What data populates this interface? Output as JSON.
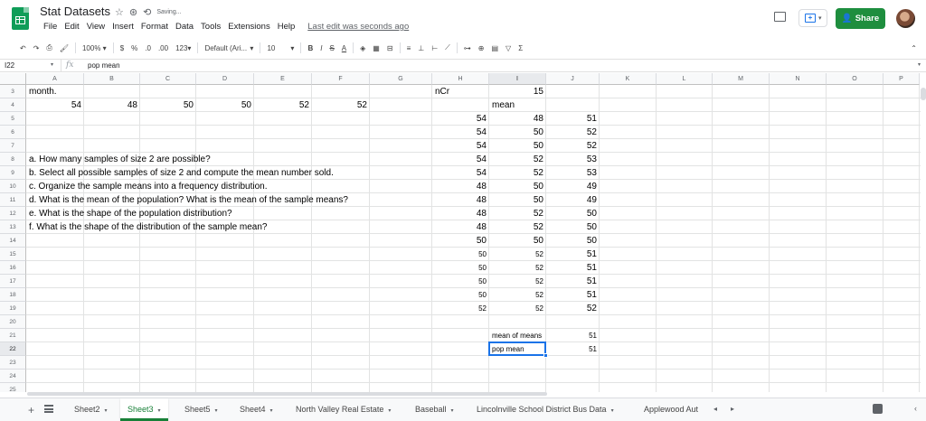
{
  "header": {
    "title": "Stat Datasets",
    "saving_text": "Saving...",
    "star_glyph": "☆",
    "drive_glyph": "⊛",
    "sync_glyph": "⟲",
    "menu": [
      "File",
      "Edit",
      "View",
      "Insert",
      "Format",
      "Data",
      "Tools",
      "Extensions",
      "Help"
    ],
    "last_edit": "Last edit was seconds ago",
    "share_label": "Share",
    "share_glyph": "👤"
  },
  "toolbar": {
    "undo": "↶",
    "redo": "↷",
    "print": "⎙",
    "paint_format": "🖌",
    "zoom": "100%",
    "currency": "$",
    "percent": "%",
    "decrease_decimal": ".0",
    "increase_decimal": ".00",
    "more_formats": "123",
    "font": "Default (Ari...",
    "font_size": "10",
    "bold": "B",
    "italic": "I",
    "strikethrough": "S",
    "text_color": "A",
    "fill_color": "◈",
    "borders": "▦",
    "merge": "⊟",
    "halign": "≡",
    "valign": "⊥",
    "wrap": "⊢",
    "rotate": "⟋",
    "link": "⊶",
    "comment": "⊕",
    "chart": "▤",
    "filter": "▽",
    "functions": "Σ",
    "caret": "▾",
    "collapse": "⌃"
  },
  "formula_bar": {
    "cell_ref": "I22",
    "fx": "fx",
    "content": "pop  mean"
  },
  "grid": {
    "columns": [
      "A",
      "B",
      "C",
      "D",
      "E",
      "F",
      "G",
      "H",
      "I",
      "J",
      "K",
      "L",
      "M",
      "N",
      "O",
      "P"
    ],
    "selected_column": "I",
    "rows": [
      "3",
      "4",
      "5",
      "6",
      "7",
      "8",
      "9",
      "10",
      "11",
      "12",
      "13",
      "14",
      "15",
      "16",
      "17",
      "18",
      "19",
      "20",
      "21",
      "22",
      "23",
      "24",
      "25"
    ],
    "selected_row": "22",
    "cells": {
      "A3": "month.",
      "A4": "54",
      "B4": "48",
      "C4": "50",
      "D4": "50",
      "E4": "52",
      "F4": "52",
      "A8": "a. How many samples of size 2 are possible?",
      "A9": "b. Select all possible samples of size 2 and compute the mean number sold.",
      "A10": "c. Organize the sample means into a frequency distribution.",
      "A11": "d. What is the mean of the population? What is the mean of the sample means?",
      "A12": "e. What is the shape of the population distribution?",
      "A13": "f. What is the shape of the distribution of the sample mean?",
      "H3": "nCr",
      "I3": "15",
      "I4": "mean",
      "H5": "54",
      "I5": "48",
      "J5": "51",
      "H6": "54",
      "I6": "50",
      "J6": "52",
      "H7": "54",
      "I7": "50",
      "J7": "52",
      "H8": "54",
      "I8": "52",
      "J8": "53",
      "H9": "54",
      "I9": "52",
      "J9": "53",
      "H10": "48",
      "I10": "50",
      "J10": "49",
      "H11": "48",
      "I11": "50",
      "J11": "49",
      "H12": "48",
      "I12": "52",
      "J12": "50",
      "H13": "48",
      "I13": "52",
      "J13": "50",
      "H14": "50",
      "I14": "50",
      "J14": "50",
      "H15": "50",
      "I15": "52",
      "J15": "51",
      "H16": "50",
      "I16": "52",
      "J16": "51",
      "H17": "50",
      "I17": "52",
      "J17": "51",
      "H18": "50",
      "I18": "52",
      "J18": "51",
      "H19": "52",
      "I19": "52",
      "J19": "52",
      "I21": "mean of means",
      "J21": "51",
      "I22": "pop mean",
      "J22": "51"
    }
  },
  "sheets": {
    "add_glyph": "+",
    "tabs": [
      "Sheet2",
      "Sheet3",
      "Sheet5",
      "Sheet4",
      "North Valley Real Estate",
      "Baseball",
      "Lincolnville School District Bus Data",
      "Applewood Aut"
    ],
    "active": "Sheet3",
    "tab_caret": "▾",
    "prev": "◂",
    "next": "▸",
    "side_toggle": "‹"
  },
  "colors": {
    "share": "#1e8e3e",
    "active_tab": "#188038",
    "selection": "#1a73e8",
    "logo": "#0f9d58"
  }
}
